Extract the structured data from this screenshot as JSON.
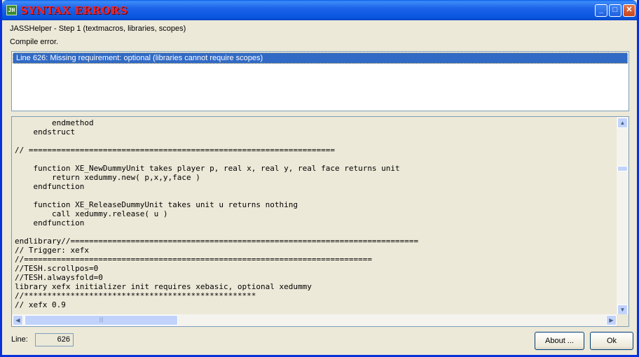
{
  "window": {
    "title": "SYNTAX ERRORS",
    "icon_name": "jasshelper-app-icon",
    "icon_text": "JH",
    "controls": {
      "minimize": "_",
      "maximize": "□",
      "close": "✕"
    }
  },
  "header": {
    "step": "JASSHelper - Step 1 (textmacros, libraries, scopes)",
    "status": "Compile error."
  },
  "errors": [
    "Line 626: Missing requirement: optional (libraries cannot require scopes)"
  ],
  "code": {
    "lines": [
      "        endmethod",
      "    endstruct",
      "",
      "// ==================================================================",
      "",
      "    function XE_NewDummyUnit takes player p, real x, real y, real face returns unit",
      "        return xedummy.new( p,x,y,face )",
      "    endfunction",
      "",
      "    function XE_ReleaseDummyUnit takes unit u returns nothing",
      "        call xedummy.release( u )",
      "    endfunction",
      "",
      "endlibrary//===========================================================================",
      "// Trigger: xefx",
      "//===========================================================================",
      "//TESH.scrollpos=0",
      "//TESH.alwaysfold=0",
      "library xefx initializer init requires xebasic, optional xedummy",
      "//**************************************************",
      "// xefx 0.9"
    ]
  },
  "footer": {
    "line_label": "Line:",
    "line_value": "626",
    "about_label": "About ...",
    "ok_label": "Ok"
  },
  "colors": {
    "title_text": "#ff2020",
    "selection": "#316ac5",
    "titlebar": "#0855dd"
  }
}
